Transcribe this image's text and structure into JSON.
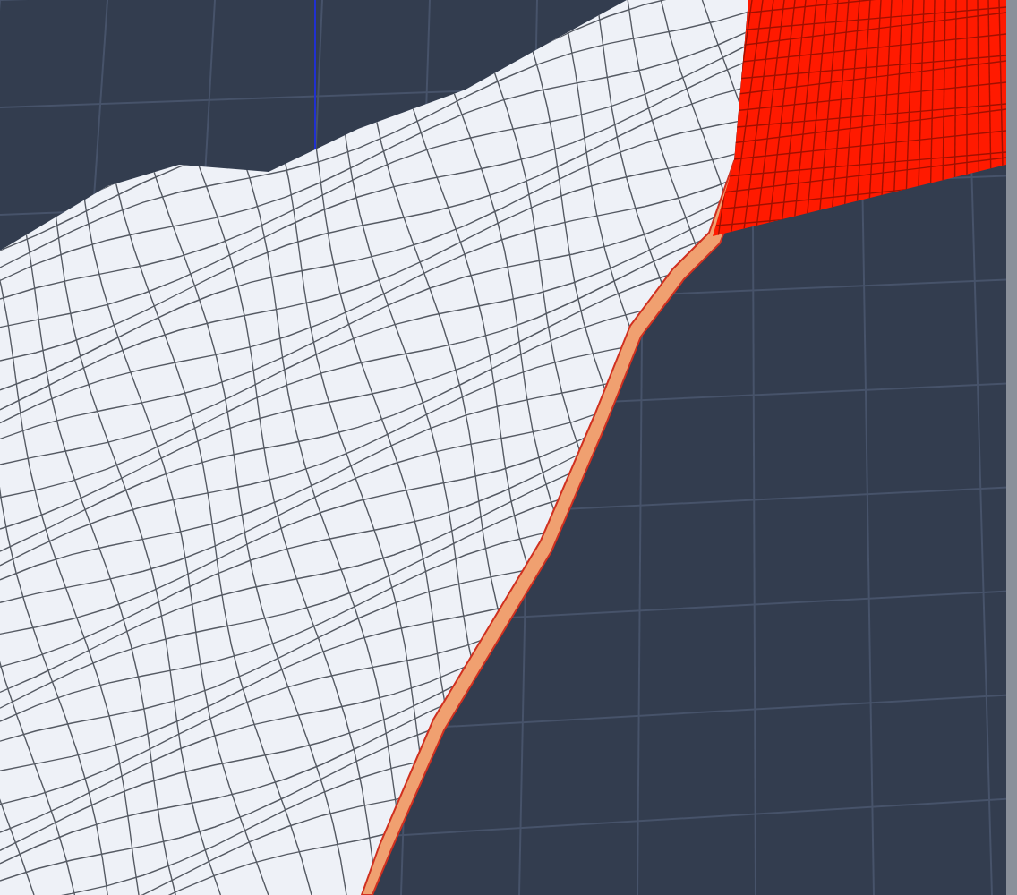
{
  "viewport": {
    "show_grid": true,
    "show_wireframe": true
  }
}
